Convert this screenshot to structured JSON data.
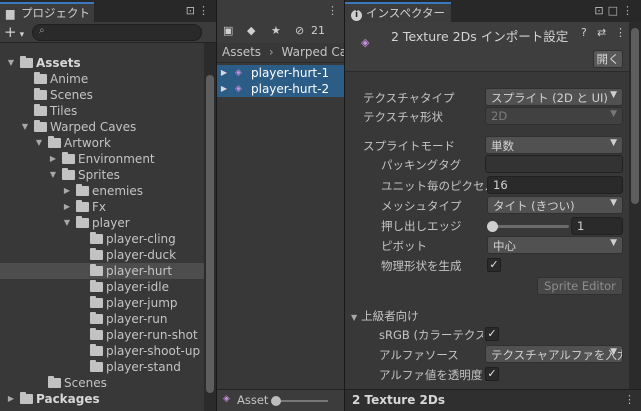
{
  "project": {
    "tab_title": "プロジェクト",
    "add_label": "+",
    "add_caret": "▾",
    "search_placeholder": "",
    "tree": [
      {
        "label": "Assets",
        "bold": true,
        "indent": 0,
        "arrow": "▼"
      },
      {
        "label": "Anime",
        "indent": 1,
        "arrow": ""
      },
      {
        "label": "Scenes",
        "indent": 1,
        "arrow": ""
      },
      {
        "label": "Tiles",
        "indent": 1,
        "arrow": ""
      },
      {
        "label": "Warped Caves",
        "indent": 1,
        "arrow": "▼"
      },
      {
        "label": "Artwork",
        "indent": 2,
        "arrow": "▼"
      },
      {
        "label": "Environment",
        "indent": 3,
        "arrow": "▶"
      },
      {
        "label": "Sprites",
        "indent": 3,
        "arrow": "▼"
      },
      {
        "label": "enemies",
        "indent": 4,
        "arrow": "▶"
      },
      {
        "label": "Fx",
        "indent": 4,
        "arrow": "▶"
      },
      {
        "label": "player",
        "indent": 4,
        "arrow": "▼"
      },
      {
        "label": "player-cling",
        "indent": 5,
        "arrow": ""
      },
      {
        "label": "player-duck",
        "indent": 5,
        "arrow": ""
      },
      {
        "label": "player-hurt",
        "indent": 5,
        "arrow": "",
        "selected": true
      },
      {
        "label": "player-idle",
        "indent": 5,
        "arrow": ""
      },
      {
        "label": "player-jump",
        "indent": 5,
        "arrow": ""
      },
      {
        "label": "player-run",
        "indent": 5,
        "arrow": ""
      },
      {
        "label": "player-run-shot",
        "indent": 5,
        "arrow": ""
      },
      {
        "label": "player-shoot-up",
        "indent": 5,
        "arrow": ""
      },
      {
        "label": "player-stand",
        "indent": 5,
        "arrow": ""
      },
      {
        "label": "Scenes",
        "indent": 2,
        "arrow": ""
      },
      {
        "label": "Packages",
        "bold": true,
        "indent": 0,
        "arrow": "▶"
      }
    ]
  },
  "assets": {
    "hidden_count": "21",
    "breadcrumb": [
      "Assets",
      "Warped Cav"
    ],
    "breadcrumb_sep": "›",
    "items": [
      "player-hurt-1",
      "player-hurt-2"
    ],
    "footer_label": "Asset"
  },
  "inspector": {
    "tab_title": "インスペクター",
    "header_title": "2 Texture 2Ds インポート設定",
    "open_button": "開く",
    "props": {
      "texture_type_label": "テクスチャタイプ",
      "texture_type_value": "スプライト (2D と UI)",
      "texture_shape_label": "テクスチャ形状",
      "texture_shape_value": "2D",
      "sprite_mode_label": "スプライトモード",
      "sprite_mode_value": "単数",
      "packing_tag_label": "パッキングタグ",
      "packing_tag_value": "",
      "ppu_label": "ユニット毎のピクセル数",
      "ppu_value": "16",
      "mesh_type_label": "メッシュタイプ",
      "mesh_type_value": "タイト (きつい)",
      "extrude_label": "押し出しエッジ",
      "extrude_value": "1",
      "pivot_label": "ピボット",
      "pivot_value": "中心",
      "physics_label": "物理形状を生成",
      "sprite_editor_button": "Sprite Editor",
      "advanced_label": "上級者向け",
      "srgb_label": "sRGB (カラーテクスチャ)",
      "alpha_source_label": "アルファソース",
      "alpha_source_value": "テクスチャアルファを入力",
      "alpha_transparency_label": "アルファ値を透明度として"
    },
    "footer_title": "2 Texture 2Ds"
  },
  "colors": {
    "accent": "#3a79bb",
    "selection": "#2c5d87"
  },
  "icons": {
    "check": "✓",
    "info": "i",
    "lock": "🔒"
  }
}
